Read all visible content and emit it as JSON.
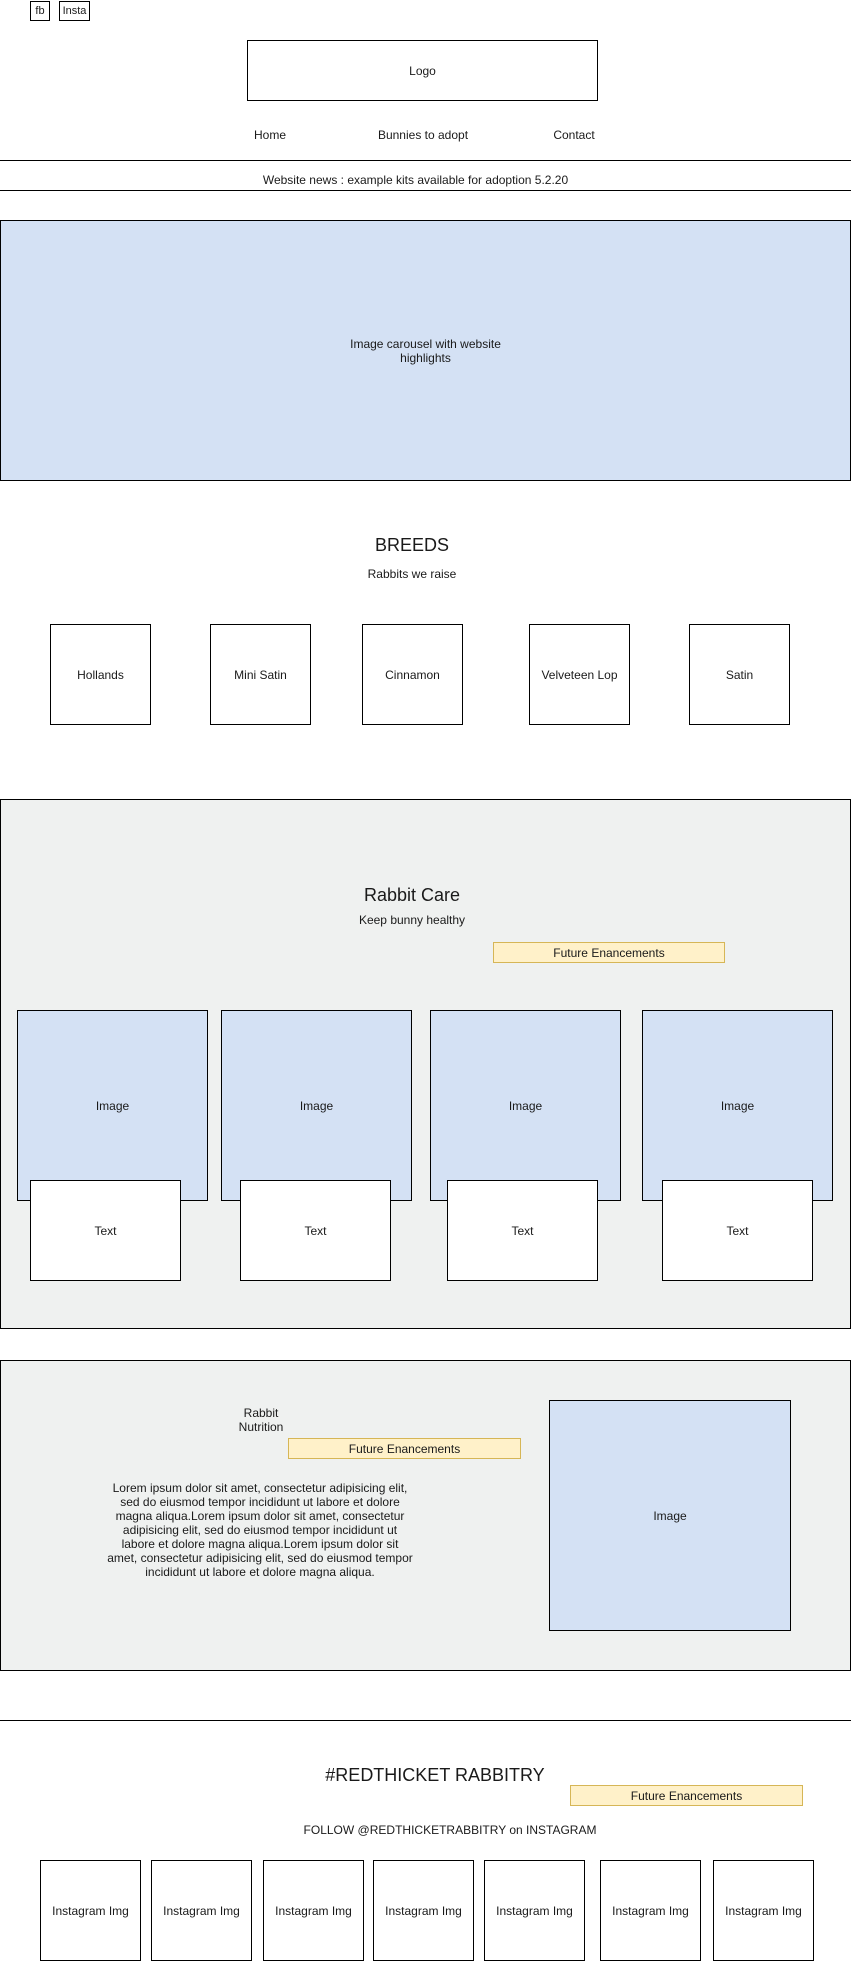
{
  "social": {
    "fb": "fb",
    "insta": "Insta"
  },
  "logo": "Logo",
  "nav": [
    "Home",
    "Bunnies to adopt",
    "Contact"
  ],
  "news": "Website news : example kits available for adoption 5.2.20",
  "carousel": "Image carousel with website highlights",
  "breeds": {
    "title": "BREEDS",
    "subtitle": "Rabbits we raise",
    "items": [
      "Hollands",
      "Mini Satin",
      "Cinnamon",
      "Velveteen Lop",
      "Satin"
    ]
  },
  "care": {
    "title": "Rabbit Care",
    "subtitle": "Keep bunny healthy",
    "future": "Future Enancements",
    "cards": [
      {
        "image": "Image",
        "text": "Text"
      },
      {
        "image": "Image",
        "text": "Text"
      },
      {
        "image": "Image",
        "text": "Text"
      },
      {
        "image": "Image",
        "text": "Text"
      }
    ]
  },
  "nutrition": {
    "title": "Rabbit Nutrition",
    "future": "Future Enancements",
    "body": "Lorem ipsum dolor sit amet, consectetur adipisicing elit, sed do eiusmod tempor incididunt ut labore et dolore magna aliqua.Lorem ipsum dolor sit amet, consectetur adipisicing elit, sed do eiusmod tempor incididunt ut labore et dolore magna aliqua.Lorem ipsum dolor sit amet, consectetur adipisicing elit, sed do eiusmod tempor incididunt ut labore et dolore magna aliqua.",
    "image": "Image"
  },
  "instagram": {
    "title": "#REDTHICKET RABBITRY",
    "future": "Future Enancements",
    "follow": "FOLLOW @REDTHICKETRABBITRY on INSTAGRAM",
    "images": [
      "Instagram Img",
      "Instagram Img",
      "Instagram Img",
      "Instagram Img",
      "Instagram Img",
      "Instagram Img",
      "Instagram Img"
    ]
  }
}
